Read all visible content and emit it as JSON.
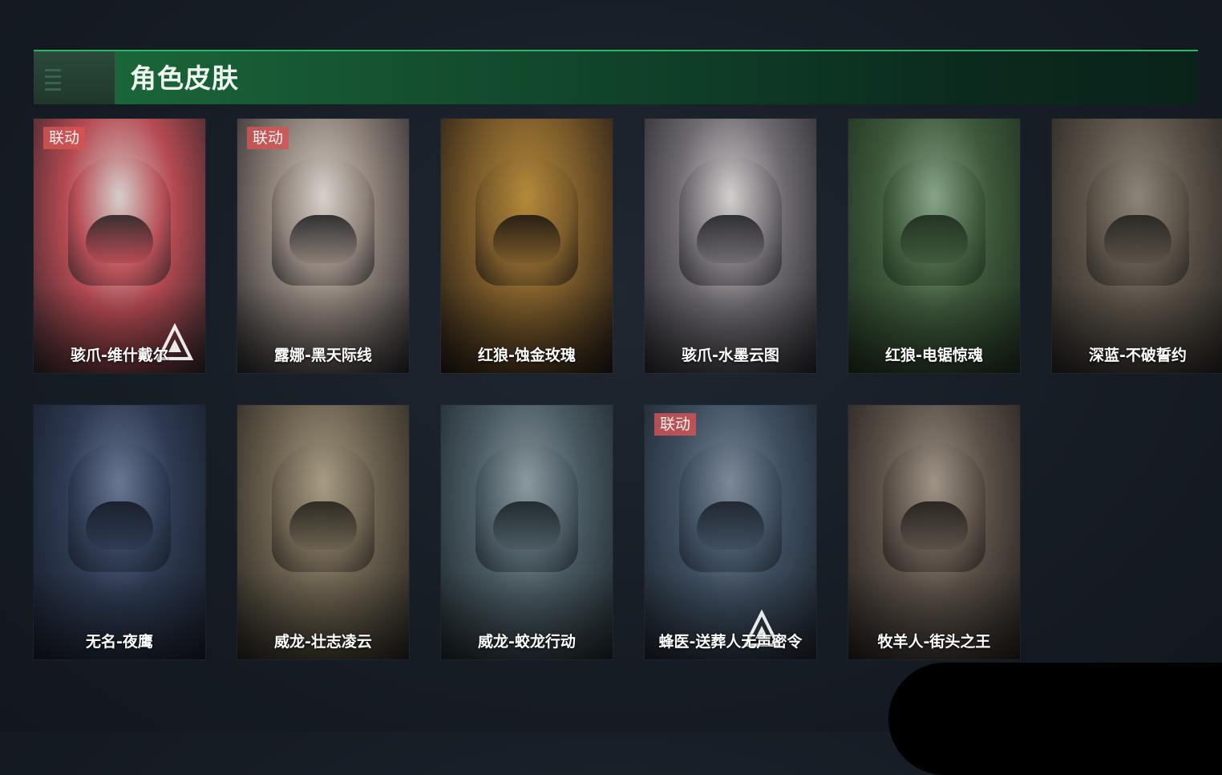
{
  "section": {
    "title": "角色皮肤"
  },
  "colors": {
    "header_accent": "#2fb564",
    "collab_badge": "#d65454"
  },
  "skins": [
    {
      "name": "骇爪-维什戴尔",
      "badge": "联动",
      "watermark": "logo-mark-icon",
      "palette": [
        "#b64a52",
        "#d6d0cc",
        "#2a2326"
      ]
    },
    {
      "name": "露娜-黑天际线",
      "badge": "联动",
      "watermark": "",
      "palette": [
        "#8a7e76",
        "#d8d2cb",
        "#222225"
      ]
    },
    {
      "name": "红狼-蚀金玫瑰",
      "badge": "",
      "watermark": "",
      "palette": [
        "#7a5a2a",
        "#b48a3a",
        "#1c1612"
      ]
    },
    {
      "name": "骇爪-水墨云图",
      "badge": "",
      "watermark": "",
      "palette": [
        "#6e6a70",
        "#d4d0cf",
        "#222226"
      ]
    },
    {
      "name": "红狼-电锯惊魂",
      "badge": "",
      "watermark": "",
      "palette": [
        "#3f5a3c",
        "#88a48a",
        "#1c2a1c"
      ]
    },
    {
      "name": "深蓝-不破誓约",
      "badge": "",
      "watermark": "",
      "palette": [
        "#5a5248",
        "#8e857a",
        "#23201d"
      ]
    },
    {
      "name": "无名-夜鹰",
      "badge": "",
      "watermark": "",
      "palette": [
        "#2e3a52",
        "#6a7894",
        "#151a25"
      ]
    },
    {
      "name": "威龙-壮志凌云",
      "badge": "",
      "watermark": "",
      "palette": [
        "#6a604e",
        "#a89c84",
        "#23211d"
      ]
    },
    {
      "name": "威龙-蛟龙行动",
      "badge": "",
      "watermark": "",
      "palette": [
        "#4a5a62",
        "#8c9aa0",
        "#1a2226"
      ]
    },
    {
      "name": "蜂医-送葬人无声密令",
      "badge": "联动",
      "watermark": "logo-mark-icon",
      "palette": [
        "#3e4e60",
        "#7d8a98",
        "#1a2028"
      ]
    },
    {
      "name": "牧羊人-街头之王",
      "badge": "",
      "watermark": "",
      "palette": [
        "#5a5048",
        "#a09486",
        "#201c19"
      ]
    }
  ]
}
